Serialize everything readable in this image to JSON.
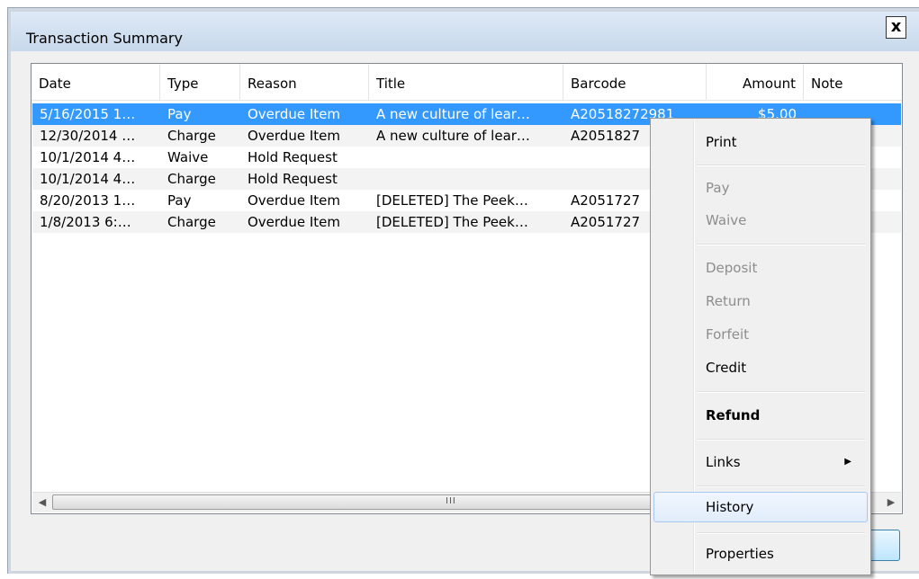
{
  "window": {
    "title": "Transaction Summary",
    "close_label": "x"
  },
  "columns": [
    "Date",
    "Type",
    "Reason",
    "Title",
    "Barcode",
    "Amount",
    "Note"
  ],
  "rows": [
    [
      "5/16/2015 1…",
      "Pay",
      "Overdue Item",
      "A new culture of lear…",
      "A20518272981",
      "$5.00",
      ""
    ],
    [
      "12/30/2014 …",
      "Charge",
      "Overdue Item",
      "A new culture of lear…",
      "A2051827",
      "",
      ""
    ],
    [
      "10/1/2014 4…",
      "Waive",
      "Hold Request",
      "",
      "",
      "",
      ""
    ],
    [
      "10/1/2014 4…",
      "Charge",
      "Hold Request",
      "",
      "",
      "",
      ""
    ],
    [
      "8/20/2013 1…",
      "Pay",
      "Overdue Item",
      "[DELETED] The Peek…",
      "A2051727",
      "",
      ""
    ],
    [
      "1/8/2013 6:…",
      "Charge",
      "Overdue Item",
      "[DELETED] The Peek…",
      "A2051727",
      "",
      ""
    ]
  ],
  "scrollbar": {
    "left_arrow": "◀",
    "right_arrow": "▶",
    "grip": "III"
  },
  "context_menu": {
    "print": "Print",
    "pay": "Pay",
    "waive": "Waive",
    "deposit": "Deposit",
    "return": "Return",
    "forfeit": "Forfeit",
    "credit": "Credit",
    "refund": "Refund",
    "links": "Links",
    "links_arrow": "▶",
    "history": "History",
    "properties": "Properties"
  },
  "colors": {
    "selection": "#3399ff",
    "menu_hover_border": "#a8c8ef",
    "disabled_text": "#8d8d8d"
  }
}
